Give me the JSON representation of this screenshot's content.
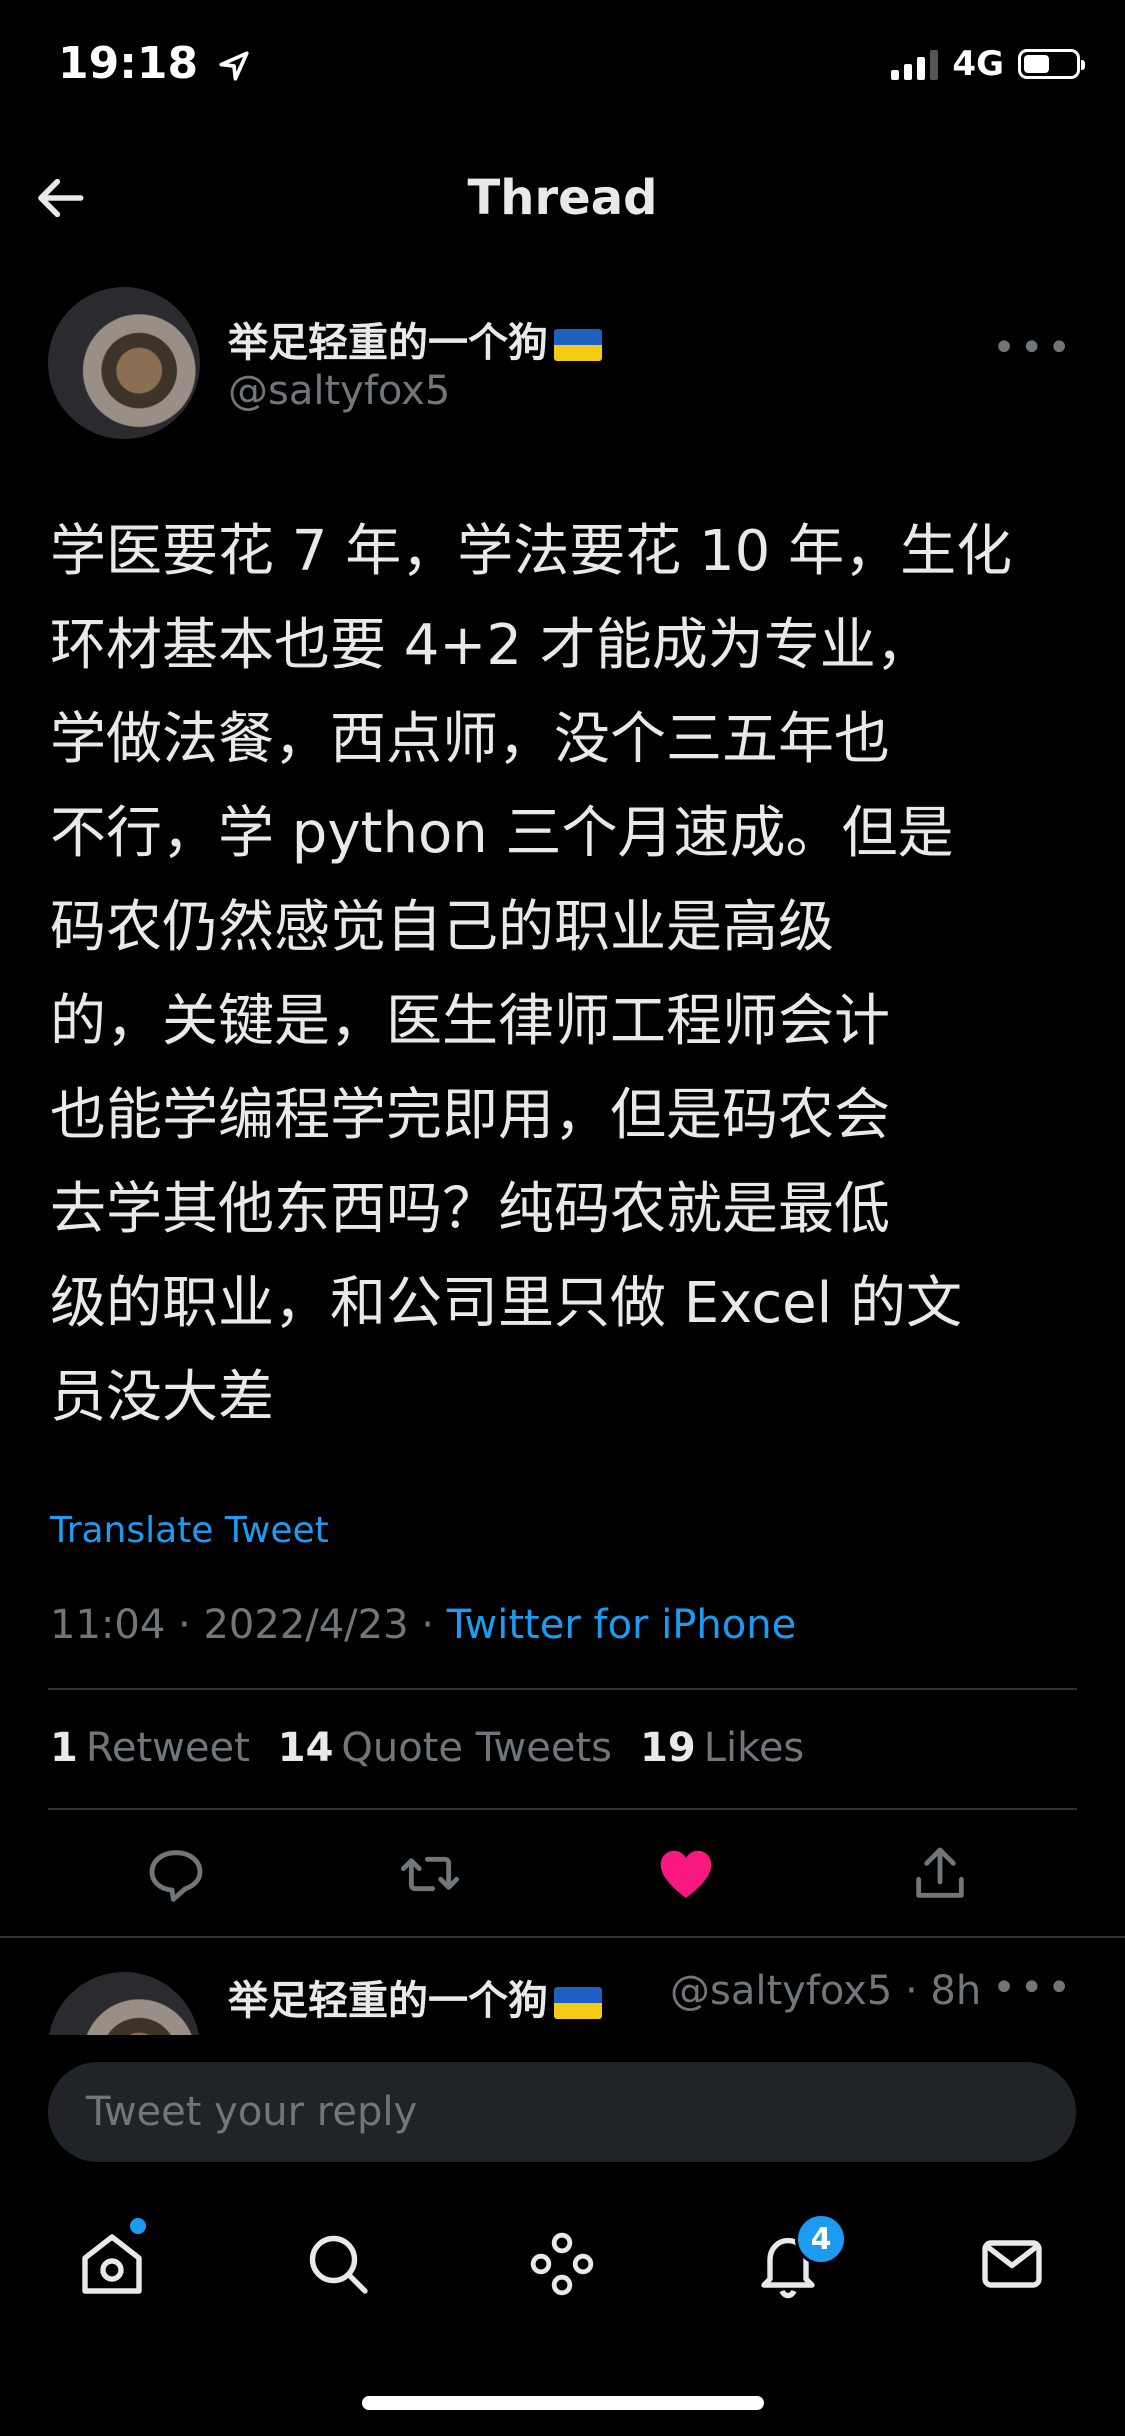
{
  "status_bar": {
    "time": "19:18",
    "network": "4G"
  },
  "header": {
    "title": "Thread"
  },
  "tweet": {
    "display_name": "举足轻重的一个狗",
    "handle": "@saltyfox5",
    "text": "学医要花 7 年，学法要花 10 年，生化\n环材基本也要 4+2 才能成为专业，\n学做法餐，西点师，没个三五年也\n不行，学 python 三个月速成。但是\n码农仍然感觉自己的职业是高级\n的，关键是，医生律师工程师会计\n也能学编程学完即用，但是码农会\n去学其他东西吗？纯码农就是最低\n级的职业，和公司里只做 Excel 的文\n员没大差",
    "translate_label": "Translate Tweet",
    "time": "11:04",
    "date": "2022/4/23",
    "source": "Twitter for iPhone",
    "retweets_count": "1",
    "retweets_label": "Retweet",
    "quotes_count": "14",
    "quotes_label": "Quote Tweets",
    "likes_count": "19",
    "likes_label": "Likes"
  },
  "reply_preview": {
    "display_name": "举足轻重的一个狗",
    "handle": "@saltyfox5",
    "age": "8h"
  },
  "composer": {
    "placeholder": "Tweet your reply"
  },
  "tab_bar": {
    "notifications_badge": "4"
  },
  "colors": {
    "accent": "#1d9bf0",
    "like": "#f91880",
    "background": "#000000",
    "muted": "#71767b"
  },
  "icons": [
    "location-arrow-icon",
    "signal-icon",
    "battery-icon",
    "back-arrow-icon",
    "more-icon",
    "reply-icon",
    "retweet-icon",
    "like-icon",
    "share-icon",
    "home-icon",
    "search-icon",
    "spaces-icon",
    "notifications-icon",
    "messages-icon"
  ]
}
